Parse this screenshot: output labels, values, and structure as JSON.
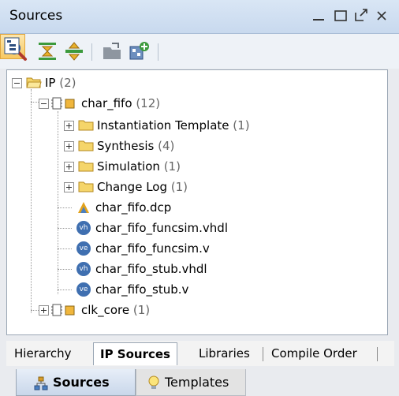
{
  "window": {
    "title": "Sources",
    "minimize_icon": "minimize-icon",
    "maximize_icon": "maximize-icon",
    "float_icon": "float-icon",
    "close_icon": "close-icon"
  },
  "toolbar": {
    "buttons": [
      {
        "icon": "search-icon"
      },
      {
        "icon": "collapse-all-icon"
      },
      {
        "icon": "expand-all-icon"
      },
      {
        "icon": "open-file-icon"
      },
      {
        "icon": "add-sources-icon"
      },
      {
        "icon": "show-hierarchy-toggle-icon",
        "active": true
      }
    ]
  },
  "tree": {
    "ip": {
      "label": "IP",
      "count": "(2)"
    },
    "char_fifo": {
      "label": "char_fifo",
      "count": "(12)"
    },
    "children": [
      {
        "label": "Instantiation Template",
        "count": "(1)"
      },
      {
        "label": "Synthesis",
        "count": "(4)"
      },
      {
        "label": "Simulation",
        "count": "(1)"
      },
      {
        "label": "Change Log",
        "count": "(1)"
      }
    ],
    "files": [
      {
        "label": "char_fifo.dcp",
        "icon": "dcp-file-icon"
      },
      {
        "label": "char_fifo_funcsim.vhdl",
        "icon": "vhdl-file-icon",
        "badge": "vh"
      },
      {
        "label": "char_fifo_funcsim.v",
        "icon": "verilog-file-icon",
        "badge": "ve"
      },
      {
        "label": "char_fifo_stub.vhdl",
        "icon": "vhdl-file-icon",
        "badge": "vh"
      },
      {
        "label": "char_fifo_stub.v",
        "icon": "verilog-file-icon",
        "badge": "ve"
      }
    ],
    "clk_core": {
      "label": "clk_core",
      "count": "(1)"
    }
  },
  "view_tabs": [
    "Hierarchy",
    "IP Sources",
    "Libraries",
    "Compile Order"
  ],
  "panel_tabs": [
    {
      "label": "Sources",
      "icon": "sources-icon"
    },
    {
      "label": "Templates",
      "icon": "lightbulb-icon"
    }
  ],
  "colors": {
    "accent": "#c8d9ee",
    "folder": "#f5d56a",
    "active_toggle": "#f7c860"
  }
}
